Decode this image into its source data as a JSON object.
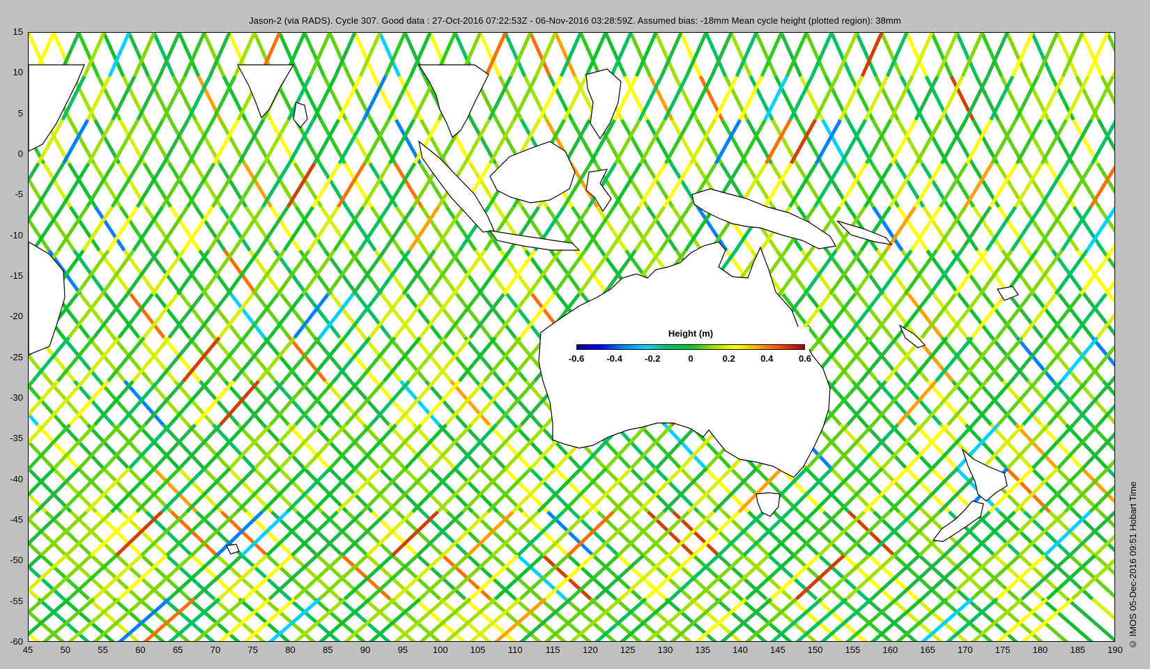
{
  "title": "Jason-2 (via RADS). Cycle 307. Good data : 27-Oct-2016 07:22:53Z - 06-Nov-2016 03:28:59Z. Assumed bias: -18mm  Mean cycle height (plotted region): 38mm",
  "credit": "© IMOS 05-Dec-2016 09:51 Hobart Time",
  "map": {
    "lon_range": [
      45,
      190
    ],
    "lat_range": [
      -60,
      15
    ],
    "x_ticks": [
      "45",
      "50",
      "55",
      "60",
      "65",
      "70",
      "75",
      "80",
      "85",
      "90",
      "95",
      "100",
      "105",
      "110",
      "115",
      "120",
      "125",
      "130",
      "135",
      "140",
      "145",
      "150",
      "155",
      "160",
      "165",
      "170",
      "175",
      "180",
      "185",
      "190"
    ],
    "y_ticks": [
      "15",
      "10",
      "5",
      "0",
      "-5",
      "-10",
      "-15",
      "-20",
      "-25",
      "-30",
      "-35",
      "-40",
      "-45",
      "-50",
      "-55",
      "-60"
    ]
  },
  "colorbar": {
    "title": "Height (m)",
    "range": [
      -0.6,
      0.6
    ],
    "ticks": [
      "-0.6",
      "-0.4",
      "-0.2",
      "0",
      "0.2",
      "0.4",
      "0.6"
    ],
    "colors": [
      "#00007f",
      "#0000ff",
      "#007fff",
      "#00d0ff",
      "#00c060",
      "#10c030",
      "#a0e000",
      "#ffff00",
      "#ffa000",
      "#ff4000",
      "#a00000"
    ]
  }
}
